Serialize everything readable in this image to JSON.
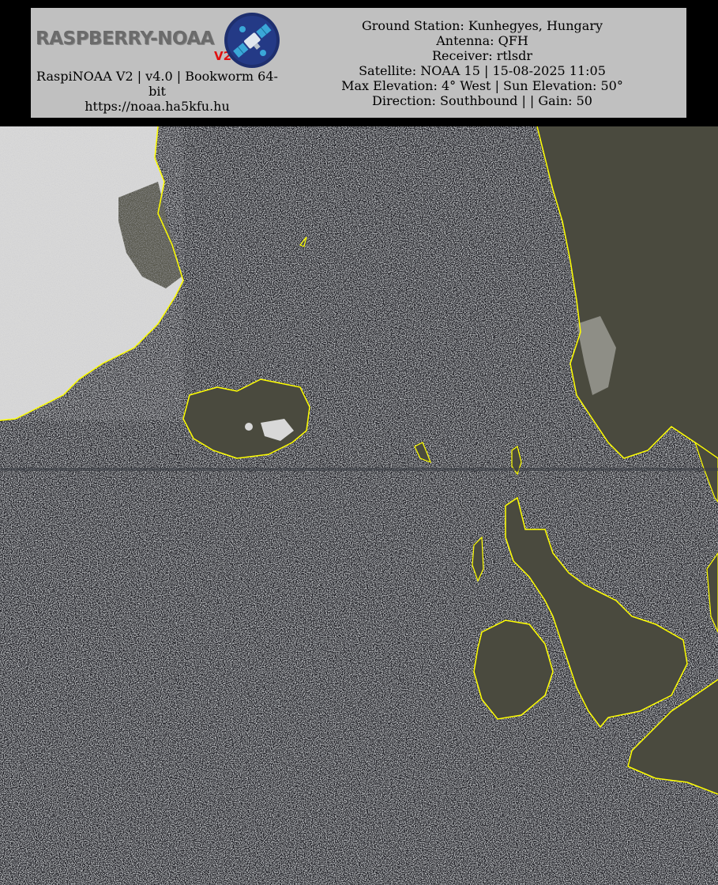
{
  "header": {
    "logo": {
      "wordmark": "RASPBERRY-NOAA",
      "version_mark": "V2"
    },
    "left_caption": {
      "line1": "RaspiNOAA V2 | v4.0 | Bookworm 64-bit",
      "line2": "https://noaa.ha5kfu.hu"
    },
    "pass_info": {
      "ground_station": "Ground Station: Kunhegyes, Hungary",
      "antenna": "Antenna: QFH",
      "receiver": "Receiver: rtlsdr",
      "satellite": "Satellite: NOAA 15 | 15-08-2025 11:05",
      "elevation": "Max Elevation: 4° West | Sun Elevation: 50°",
      "direction": "Direction: Southbound | | Gain: 50"
    }
  },
  "map": {
    "coastline_color": "#ffff00",
    "noise_base_color": "#1a1d24",
    "land_color": "#4a4a3e",
    "ice_color": "#d8d8d8"
  }
}
